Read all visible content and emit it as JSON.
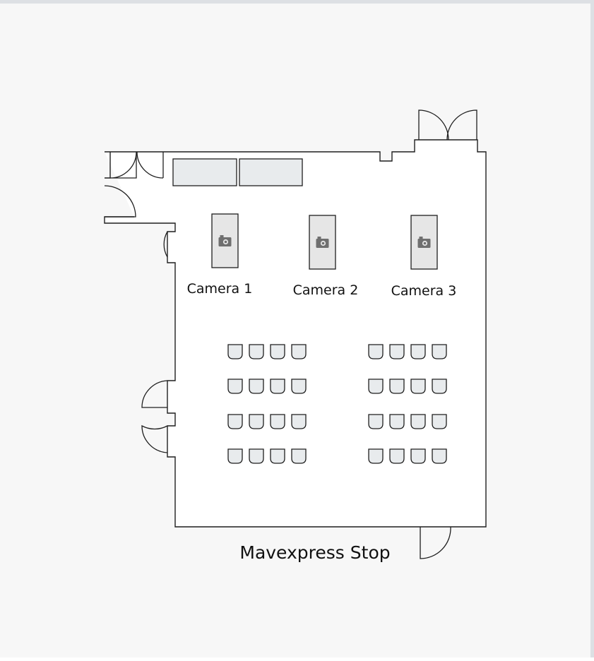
{
  "room": {
    "name": "Mavexpress Stop"
  },
  "cameras": [
    {
      "label": "Camera 1",
      "icon": "camera-icon"
    },
    {
      "label": "Camera 2",
      "icon": "camera-icon"
    },
    {
      "label": "Camera 3",
      "icon": "camera-icon"
    }
  ],
  "seating": {
    "blocks": 2,
    "rows_per_block": 4,
    "chairs_per_row": 4
  },
  "colors": {
    "background": "#f7f7f7",
    "frame_border": "#dde0e4",
    "wall_stroke": "#1f1f1f",
    "furniture_fill": "#e8ebed",
    "camera_icon": "#6f6f6f"
  }
}
